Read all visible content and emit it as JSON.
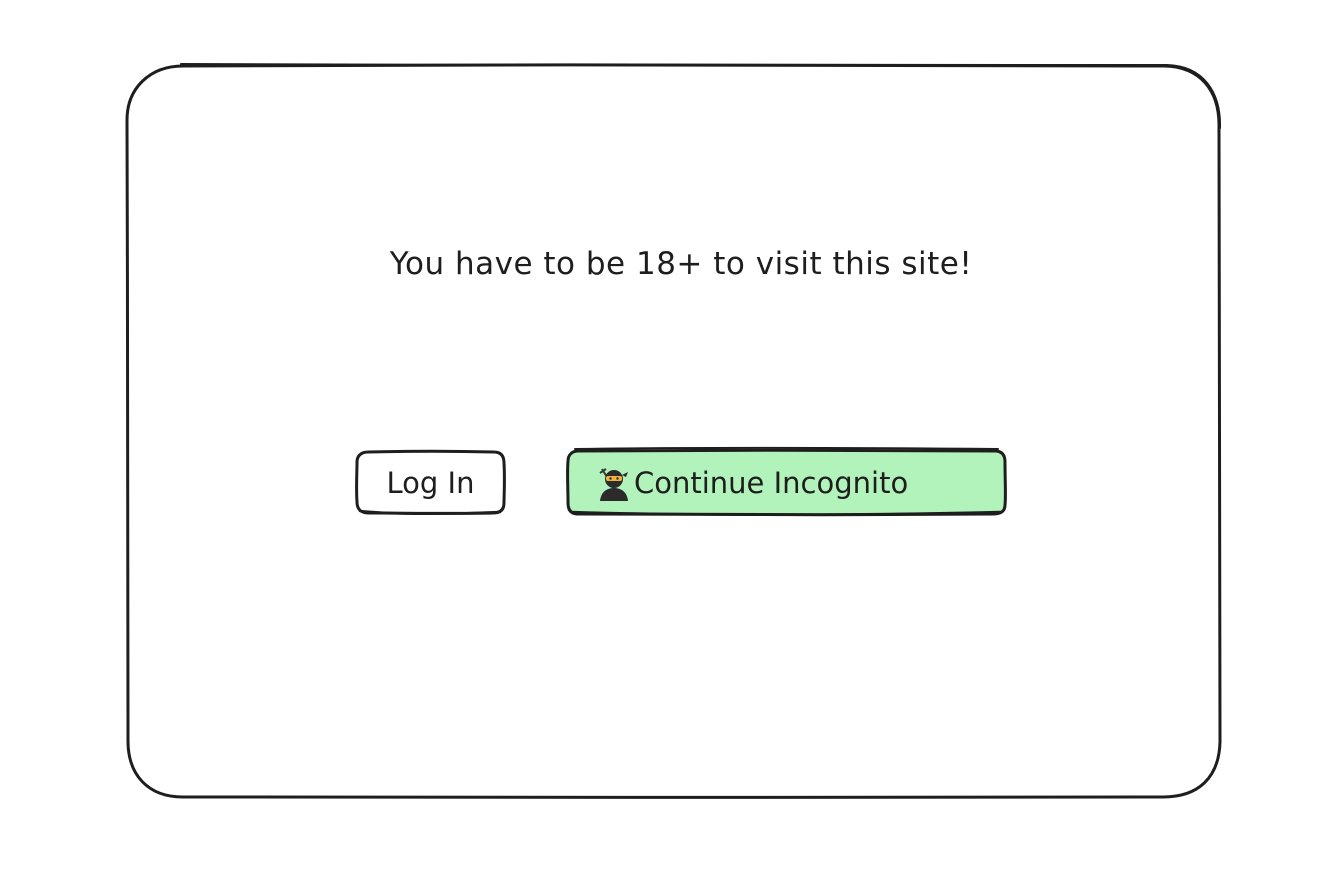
{
  "dialog": {
    "message": "You have to be 18+ to visit this site!"
  },
  "buttons": {
    "login_label": "Log In",
    "incognito_label": "Continue Incognito",
    "incognito_icon": "ninja-icon"
  },
  "colors": {
    "stroke": "#1e1e1e",
    "incognito_fill": "#b2f2bb",
    "background": "#ffffff"
  }
}
